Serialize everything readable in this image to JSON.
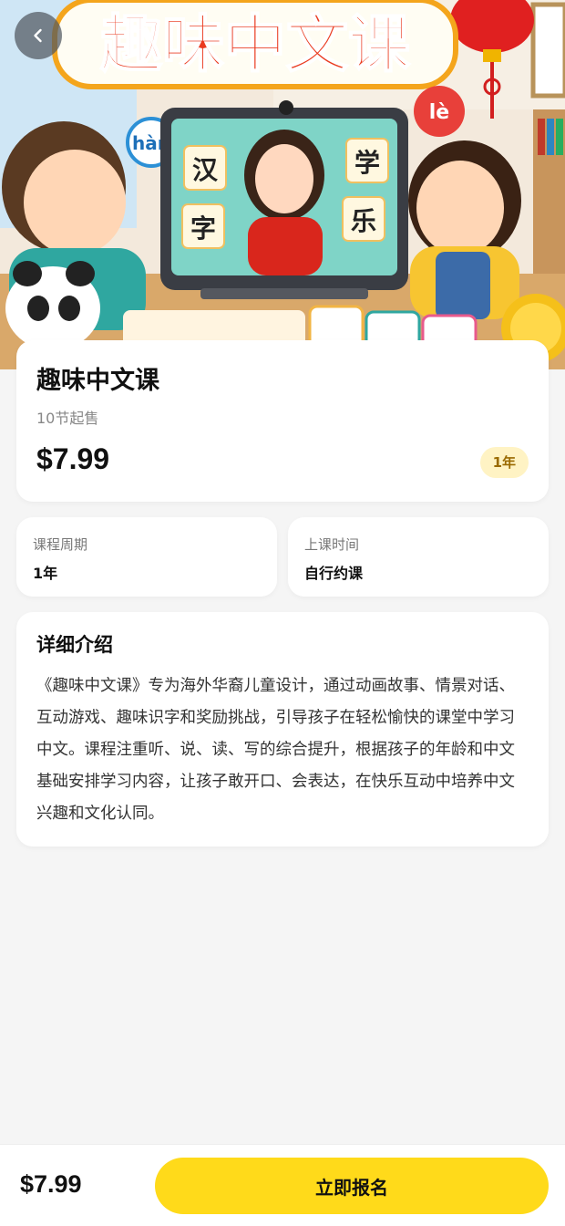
{
  "hero": {
    "banner_title": "趣味中文课",
    "pinyin_left": "hàn",
    "pinyin_right": "lè",
    "char_cards": [
      "汉",
      "字",
      "学",
      "乐"
    ]
  },
  "course": {
    "title": "趣味中文课",
    "subtitle": "10节起售",
    "price": "$7.99",
    "badge": "1年"
  },
  "info": {
    "period_label": "课程周期",
    "period_value": "1年",
    "time_label": "上课时间",
    "time_value": "自行约课"
  },
  "description": {
    "title": "详细介绍",
    "body": "《趣味中文课》专为海外华裔儿童设计，通过动画故事、情景对话、互动游戏、趣味识字和奖励挑战，引导孩子在轻松愉快的课堂中学习中文。课程注重听、说、读、写的综合提升，根据孩子的年龄和中文基础安排学习内容，让孩子敢开口、会表达，在快乐互动中培养中文兴趣和文化认同。"
  },
  "footer": {
    "price": "$7.99",
    "cta_label": "立即报名"
  },
  "colors": {
    "accent": "#ffda1a",
    "badge_bg": "#fff3c4",
    "badge_text": "#9a6a00"
  }
}
